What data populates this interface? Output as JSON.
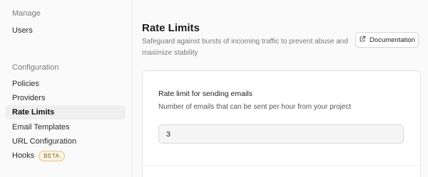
{
  "sidebar": {
    "groups": [
      {
        "title": "Manage",
        "items": [
          {
            "label": "Users"
          }
        ]
      },
      {
        "title": "Configuration",
        "items": [
          {
            "label": "Policies"
          },
          {
            "label": "Providers"
          },
          {
            "label": "Rate Limits",
            "active": true
          },
          {
            "label": "Email Templates"
          },
          {
            "label": "URL Configuration"
          },
          {
            "label": "Hooks",
            "badge": "BETA"
          }
        ]
      }
    ]
  },
  "header": {
    "title": "Rate Limits",
    "description": "Safeguard against bursts of incoming traffic to prevent abuse and maximize stability",
    "doc_button_label": "Documentation",
    "doc_icon": "external-link-icon"
  },
  "form": {
    "email_rate": {
      "label": "Rate limit for sending emails",
      "help": "Number of emails that can be sent per hour from your project",
      "value": "3"
    }
  },
  "colors": {
    "active_bg": "#efefef",
    "badge_border": "#e3c48c",
    "badge_bg": "#fbf3e2"
  }
}
